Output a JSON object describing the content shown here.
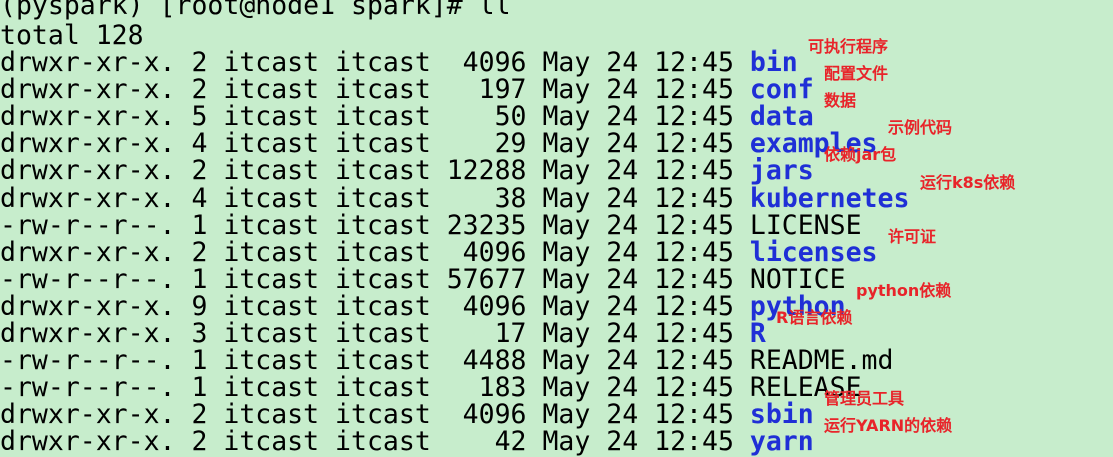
{
  "terminal": {
    "prompt": "(pyspark) [root@node1 spark]# ll",
    "total": "total 128",
    "rows": [
      {
        "perm": "drwxr-xr-x.",
        "links": "2",
        "user": "itcast",
        "group": "itcast",
        "size": "4096",
        "month": "May",
        "day": "24",
        "time": "12:45",
        "name": "bin",
        "is_dir": true
      },
      {
        "perm": "drwxr-xr-x.",
        "links": "2",
        "user": "itcast",
        "group": "itcast",
        "size": "197",
        "month": "May",
        "day": "24",
        "time": "12:45",
        "name": "conf",
        "is_dir": true
      },
      {
        "perm": "drwxr-xr-x.",
        "links": "5",
        "user": "itcast",
        "group": "itcast",
        "size": "50",
        "month": "May",
        "day": "24",
        "time": "12:45",
        "name": "data",
        "is_dir": true
      },
      {
        "perm": "drwxr-xr-x.",
        "links": "4",
        "user": "itcast",
        "group": "itcast",
        "size": "29",
        "month": "May",
        "day": "24",
        "time": "12:45",
        "name": "examples",
        "is_dir": true
      },
      {
        "perm": "drwxr-xr-x.",
        "links": "2",
        "user": "itcast",
        "group": "itcast",
        "size": "12288",
        "month": "May",
        "day": "24",
        "time": "12:45",
        "name": "jars",
        "is_dir": true
      },
      {
        "perm": "drwxr-xr-x.",
        "links": "4",
        "user": "itcast",
        "group": "itcast",
        "size": "38",
        "month": "May",
        "day": "24",
        "time": "12:45",
        "name": "kubernetes",
        "is_dir": true
      },
      {
        "perm": "-rw-r--r--.",
        "links": "1",
        "user": "itcast",
        "group": "itcast",
        "size": "23235",
        "month": "May",
        "day": "24",
        "time": "12:45",
        "name": "LICENSE",
        "is_dir": false
      },
      {
        "perm": "drwxr-xr-x.",
        "links": "2",
        "user": "itcast",
        "group": "itcast",
        "size": "4096",
        "month": "May",
        "day": "24",
        "time": "12:45",
        "name": "licenses",
        "is_dir": true
      },
      {
        "perm": "-rw-r--r--.",
        "links": "1",
        "user": "itcast",
        "group": "itcast",
        "size": "57677",
        "month": "May",
        "day": "24",
        "time": "12:45",
        "name": "NOTICE",
        "is_dir": false
      },
      {
        "perm": "drwxr-xr-x.",
        "links": "9",
        "user": "itcast",
        "group": "itcast",
        "size": "4096",
        "month": "May",
        "day": "24",
        "time": "12:45",
        "name": "python",
        "is_dir": true
      },
      {
        "perm": "drwxr-xr-x.",
        "links": "3",
        "user": "itcast",
        "group": "itcast",
        "size": "17",
        "month": "May",
        "day": "24",
        "time": "12:45",
        "name": "R",
        "is_dir": true
      },
      {
        "perm": "-rw-r--r--.",
        "links": "1",
        "user": "itcast",
        "group": "itcast",
        "size": "4488",
        "month": "May",
        "day": "24",
        "time": "12:45",
        "name": "README.md",
        "is_dir": false
      },
      {
        "perm": "-rw-r--r--.",
        "links": "1",
        "user": "itcast",
        "group": "itcast",
        "size": "183",
        "month": "May",
        "day": "24",
        "time": "12:45",
        "name": "RELEASE",
        "is_dir": false
      },
      {
        "perm": "drwxr-xr-x.",
        "links": "2",
        "user": "itcast",
        "group": "itcast",
        "size": "4096",
        "month": "May",
        "day": "24",
        "time": "12:45",
        "name": "sbin",
        "is_dir": true
      },
      {
        "perm": "drwxr-xr-x.",
        "links": "2",
        "user": "itcast",
        "group": "itcast",
        "size": "42",
        "month": "May",
        "day": "24",
        "time": "12:45",
        "name": "yarn",
        "is_dir": true
      }
    ]
  },
  "annotations": [
    {
      "row": 0,
      "text": "可执行程序"
    },
    {
      "row": 1,
      "text": "配置文件"
    },
    {
      "row": 2,
      "text": "数据"
    },
    {
      "row": 3,
      "text": "示例代码"
    },
    {
      "row": 4,
      "text": "依赖jar包"
    },
    {
      "row": 5,
      "text": "运行k8s依赖"
    },
    {
      "row": 7,
      "text": "许可证"
    },
    {
      "row": 9,
      "text": "python依赖"
    },
    {
      "row": 10,
      "text": "R语言依赖"
    },
    {
      "row": 13,
      "text": "管理员工具"
    },
    {
      "row": 14,
      "text": "运行YARN的依赖"
    }
  ],
  "colors": {
    "background": "#c7edcc",
    "text": "#000000",
    "directory": "#1f2fd6",
    "annotation": "#e8242a"
  }
}
